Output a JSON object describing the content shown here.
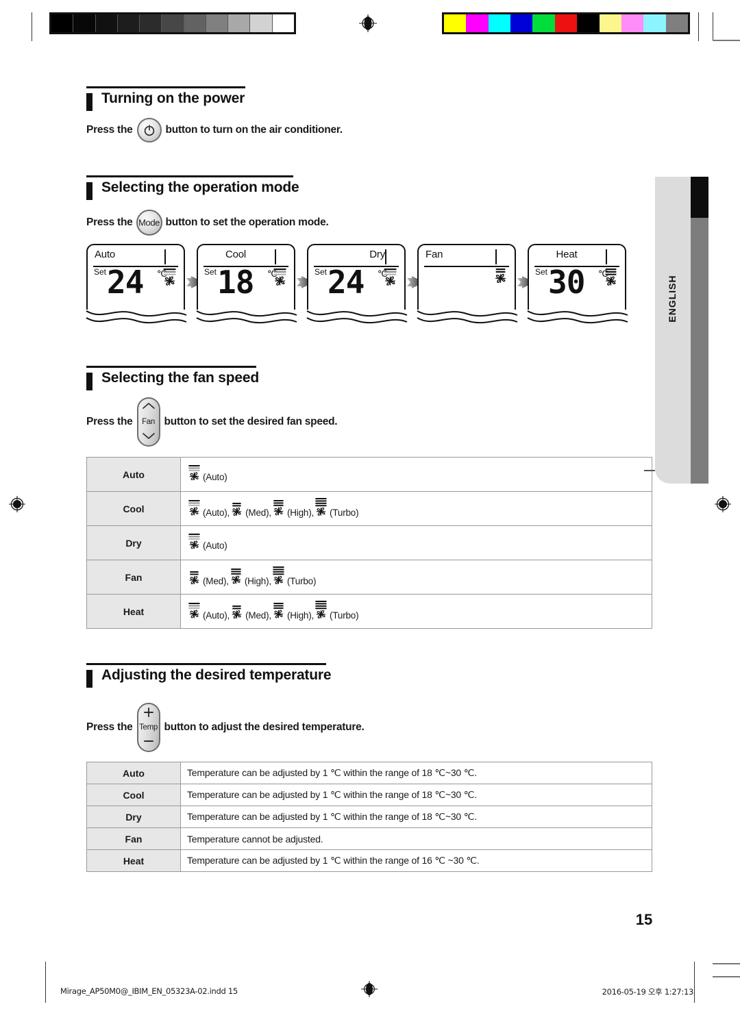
{
  "document": {
    "page_number": "15",
    "language_tab": "ENGLISH",
    "footer_left": "Mirage_AP50M0@_IBIM_EN_05323A-02.indd   15",
    "footer_right": "2016-05-19   오후 1:27:13"
  },
  "calibration": {
    "grayscale": [
      "#000000",
      "#080808",
      "#111111",
      "#1d1d1d",
      "#2c2c2c",
      "#474747",
      "#626262",
      "#808080",
      "#a8a8a8",
      "#d2d2d2",
      "#ffffff"
    ],
    "colorscale": [
      "#ffff00",
      "#ff00ff",
      "#00ffff",
      "#0000d8",
      "#00dd3c",
      "#ee1111",
      "#000000",
      "#fdf68c",
      "#ff8cf8",
      "#8cf4ff",
      "#7f7f7f"
    ]
  },
  "sections": {
    "power": {
      "heading": "Turning on the power",
      "instruction_before": "Press the",
      "instruction_after": "button to turn on the air conditioner.",
      "button_icon": "power-icon"
    },
    "mode": {
      "heading": "Selecting the operation mode",
      "instruction_before": "Press the",
      "button_label": "Mode",
      "instruction_after": "button to set the operation mode."
    },
    "fan": {
      "heading": "Selecting the fan speed",
      "instruction_before": "Press the",
      "button_label": "Fan",
      "instruction_after": "button to set the desired fan speed."
    },
    "temp": {
      "heading": "Adjusting the desired temperature",
      "instruction_before": "Press the",
      "button_label": "Temp",
      "instruction_after": "button to adjust the desired temperature."
    }
  },
  "lcd_sequence": [
    {
      "mode": "Auto",
      "align": "left",
      "set_label": "Set",
      "value": "24",
      "unit": "℃",
      "fan_icon": "fan-auto",
      "show_value": true
    },
    {
      "mode": "Cool",
      "align": "center",
      "set_label": "Set",
      "value": "18",
      "unit": "℃",
      "fan_icon": "fan-auto",
      "show_value": true
    },
    {
      "mode": "Dry",
      "align": "right",
      "set_label": "Set",
      "value": "24",
      "unit": "℃",
      "fan_icon": "fan-auto",
      "show_value": true
    },
    {
      "mode": "Fan",
      "align": "left",
      "set_label": "",
      "value": "",
      "unit": "",
      "fan_icon": "fan-med",
      "show_value": false
    },
    {
      "mode": "Heat",
      "align": "center",
      "set_label": "Set",
      "value": "30",
      "unit": "℃",
      "fan_icon": "fan-high",
      "show_value": true
    }
  ],
  "fan_speed_table": {
    "rows": [
      {
        "mode": "Auto",
        "speeds": [
          {
            "icon": "fan-auto",
            "label": "(Auto)"
          }
        ]
      },
      {
        "mode": "Cool",
        "speeds": [
          {
            "icon": "fan-auto",
            "label": "(Auto),"
          },
          {
            "icon": "fan-med",
            "label": "(Med),"
          },
          {
            "icon": "fan-high",
            "label": "(High),"
          },
          {
            "icon": "fan-turbo",
            "label": "(Turbo)"
          }
        ]
      },
      {
        "mode": "Dry",
        "speeds": [
          {
            "icon": "fan-auto",
            "label": "(Auto)"
          }
        ]
      },
      {
        "mode": "Fan",
        "speeds": [
          {
            "icon": "fan-med",
            "label": "(Med),"
          },
          {
            "icon": "fan-high",
            "label": "(High),"
          },
          {
            "icon": "fan-turbo",
            "label": "(Turbo)"
          }
        ]
      },
      {
        "mode": "Heat",
        "speeds": [
          {
            "icon": "fan-auto",
            "label": "(Auto),"
          },
          {
            "icon": "fan-med",
            "label": "(Med),"
          },
          {
            "icon": "fan-high",
            "label": "(High),"
          },
          {
            "icon": "fan-turbo",
            "label": "(Turbo)"
          }
        ]
      }
    ]
  },
  "temperature_table": {
    "rows": [
      {
        "mode": "Auto",
        "text": "Temperature can be adjusted by 1 ℃ within the range of 18 ℃~30 ℃."
      },
      {
        "mode": "Cool",
        "text": "Temperature can be adjusted by 1 ℃ within the range of 18 ℃~30 ℃."
      },
      {
        "mode": "Dry",
        "text": "Temperature can be adjusted by 1 ℃ within the range of 18 ℃~30 ℃."
      },
      {
        "mode": "Fan",
        "text": "Temperature cannot be adjusted."
      },
      {
        "mode": "Heat",
        "text": "Temperature can be adjusted by 1 ℃ within the range of 16 ℃ ~30 ℃."
      }
    ]
  }
}
